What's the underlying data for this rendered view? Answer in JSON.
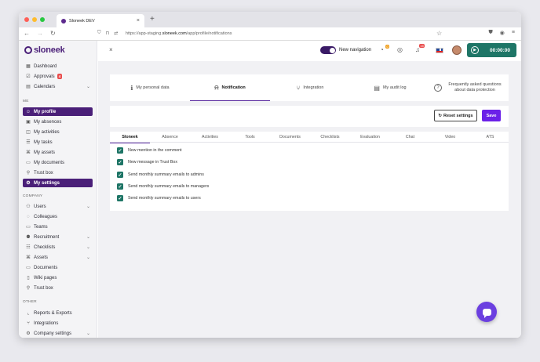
{
  "browser": {
    "tab_title": "Sloneek DEV",
    "tab_close": "×",
    "new_tab": "+",
    "url_prefix": "https://app-staging.",
    "url_domain": "sloneek.com",
    "url_path": "/app/profile/notifications"
  },
  "sidebar": {
    "logo": "sloneek",
    "top_items": [
      {
        "label": "Dashboard",
        "icon": "dashboard-icon",
        "glyph": "▦"
      },
      {
        "label": "Approvals",
        "icon": "approvals-icon",
        "glyph": "☑",
        "badge": "4"
      },
      {
        "label": "Calendars",
        "icon": "calendar-icon",
        "glyph": "▤",
        "chevron": "⌄"
      }
    ],
    "me_title": "ME",
    "me_items": [
      {
        "label": "My profile",
        "icon": "user-icon",
        "glyph": "☺",
        "active": true
      },
      {
        "label": "My absences",
        "icon": "absence-icon",
        "glyph": "▣"
      },
      {
        "label": "My activities",
        "icon": "activities-icon",
        "glyph": "◫"
      },
      {
        "label": "My tasks",
        "icon": "tasks-icon",
        "glyph": "☰"
      },
      {
        "label": "My assets",
        "icon": "assets-icon",
        "glyph": "⌘"
      },
      {
        "label": "My documents",
        "icon": "folder-icon",
        "glyph": "▭"
      },
      {
        "label": "Trust box",
        "icon": "trustbox-icon",
        "glyph": "⚲"
      },
      {
        "label": "My settings",
        "icon": "gear-icon",
        "glyph": "⚙",
        "active": true
      }
    ],
    "company_title": "COMPANY",
    "company_items": [
      {
        "label": "Users",
        "icon": "users-icon",
        "glyph": "⚇",
        "chevron": "⌄"
      },
      {
        "label": "Colleagues",
        "icon": "colleagues-icon",
        "glyph": "◌"
      },
      {
        "label": "Teams",
        "icon": "teams-icon",
        "glyph": "▭"
      },
      {
        "label": "Recruitment",
        "icon": "recruitment-icon",
        "glyph": "⚉",
        "chevron": "⌄"
      },
      {
        "label": "Checklists",
        "icon": "checklist-icon",
        "glyph": "☷",
        "chevron": "⌄"
      },
      {
        "label": "Assets",
        "icon": "assets-icon",
        "glyph": "⌘",
        "chevron": "⌄"
      },
      {
        "label": "Documents",
        "icon": "folder-icon",
        "glyph": "▭"
      },
      {
        "label": "Wiki pages",
        "icon": "wiki-icon",
        "glyph": "▯"
      },
      {
        "label": "Trust box",
        "icon": "trustbox-icon",
        "glyph": "⚲"
      }
    ],
    "other_title": "OTHER",
    "other_items": [
      {
        "label": "Reports & Exports",
        "icon": "reports-icon",
        "glyph": "⌞"
      },
      {
        "label": "Integrations",
        "icon": "integrations-icon",
        "glyph": "⑂"
      },
      {
        "label": "Company settings",
        "icon": "gear-icon",
        "glyph": "⚙",
        "chevron": "⌄"
      }
    ]
  },
  "topbar": {
    "new_navigation": "New navigation",
    "notif_badge_1": "0",
    "notif_badge_2": "15",
    "timer": "00:00:00"
  },
  "sections": [
    {
      "label": "My personal data",
      "icon": "info-icon",
      "glyph": "ℹ"
    },
    {
      "label": "Notification",
      "icon": "bell-icon",
      "glyph": "🔔",
      "active": true
    },
    {
      "label": "Integration",
      "icon": "integration-icon",
      "glyph": "⑂"
    },
    {
      "label": "My audit log",
      "icon": "document-icon",
      "glyph": "▤"
    },
    {
      "label": "Frequently asked questions about data protection",
      "icon": "question-icon",
      "glyph": "?"
    }
  ],
  "actions": {
    "reset": "Reset settings",
    "save": "Save"
  },
  "panel_tabs": [
    "Sloneek",
    "Absence",
    "Activities",
    "Tools",
    "Documents",
    "Checklists",
    "Evaluation",
    "Chat",
    "Video",
    "ATS"
  ],
  "active_panel_tab": "Sloneek",
  "settings": [
    {
      "label": "New mention in the comment",
      "checked": true
    },
    {
      "label": "New message in Trust Box",
      "checked": true
    },
    {
      "label": "Send monthly summary emails to admins",
      "checked": true
    },
    {
      "label": "Send monthly summary emails to managers",
      "checked": true
    },
    {
      "label": "Send monthly summary emails to users",
      "checked": true
    }
  ],
  "colors": {
    "brand": "#4a1f78",
    "primary_button": "#6b21e8",
    "checkbox": "#1e7566",
    "timer": "#1e7566"
  }
}
